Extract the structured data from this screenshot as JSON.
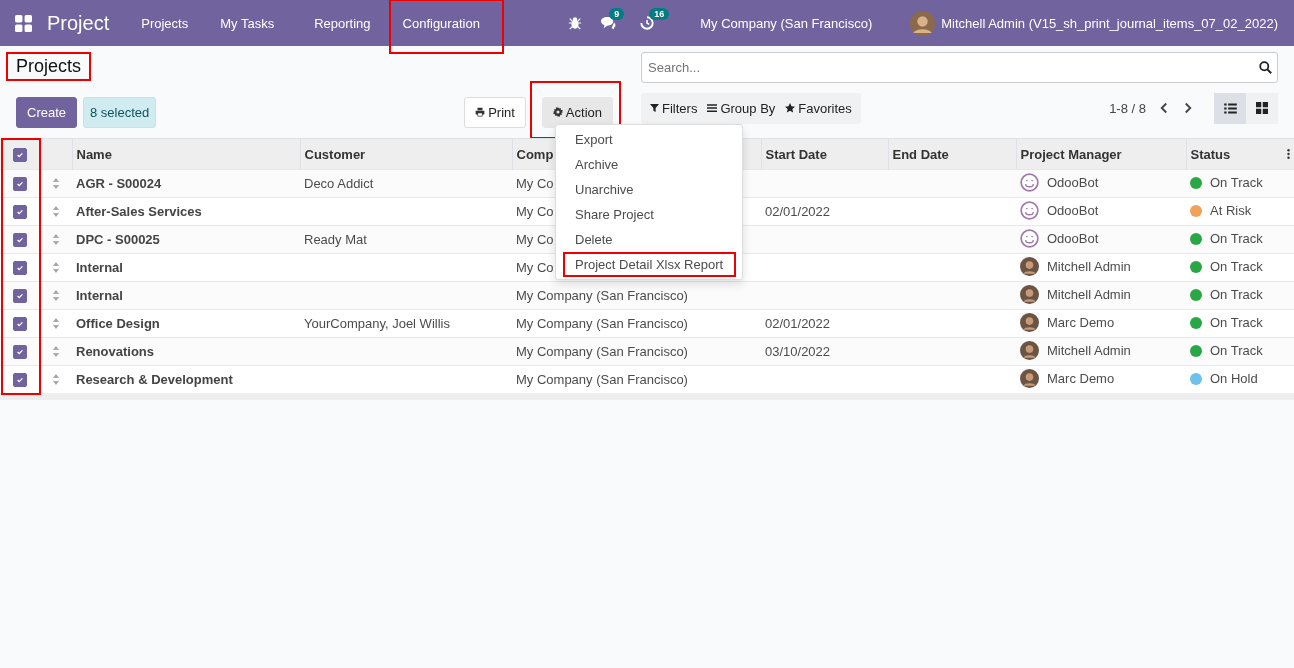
{
  "navbar": {
    "app_name": "Project",
    "menu": [
      {
        "label": "Projects",
        "highlighted": false
      },
      {
        "label": "My Tasks",
        "highlighted": false
      },
      {
        "label": "Reporting",
        "highlighted": false
      },
      {
        "label": "Configuration",
        "highlighted": true
      }
    ],
    "messages_count": "9",
    "activities_count": "16",
    "company": "My Company (San Francisco)",
    "user": "Mitchell Admin (V15_sh_print_journal_items_07_02_2022)"
  },
  "title": {
    "text": "Projects",
    "highlighted": true
  },
  "buttons": {
    "create": "Create",
    "selected": "8 selected",
    "print": "Print",
    "action": "Action",
    "action_highlighted": true
  },
  "search": {
    "placeholder": "Search..."
  },
  "filters": [
    "Filters",
    "Group By",
    "Favorites"
  ],
  "pager": "1-8 / 8",
  "views": [
    {
      "kind": "list",
      "selected": true
    },
    {
      "kind": "kanban",
      "selected": false
    }
  ],
  "action_menu": [
    {
      "label": "Export",
      "highlighted": false
    },
    {
      "label": "Archive",
      "highlighted": false
    },
    {
      "label": "Unarchive",
      "highlighted": false
    },
    {
      "label": "Share Project",
      "highlighted": false
    },
    {
      "label": "Delete",
      "highlighted": false
    },
    {
      "label": "Project Detail Xlsx Report",
      "highlighted": true
    }
  ],
  "table": {
    "select_all_checked": true,
    "select_column_highlighted": true,
    "columns": [
      "Name",
      "Customer",
      "Comp",
      "Start Date",
      "End Date",
      "Project Manager",
      "Status"
    ],
    "rows": [
      {
        "checked": true,
        "name": "AGR - S00024",
        "customer": "Deco Addict",
        "company": "My Co",
        "start_date": "",
        "end_date": "",
        "manager": "OdooBot",
        "kind": "bot",
        "status": "On Track",
        "color": "#28a745"
      },
      {
        "checked": true,
        "name": "After-Sales Services",
        "customer": "",
        "company": "My Co",
        "start_date": "02/01/2022",
        "end_date": "",
        "manager": "OdooBot",
        "kind": "bot",
        "status": "At Risk",
        "color": "#f0a15a"
      },
      {
        "checked": true,
        "name": "DPC - S00025",
        "customer": "Ready Mat",
        "company": "My Co",
        "start_date": "",
        "end_date": "",
        "manager": "OdooBot",
        "kind": "bot",
        "status": "On Track",
        "color": "#28a745"
      },
      {
        "checked": true,
        "name": "Internal",
        "customer": "",
        "company": "My Co",
        "start_date": "",
        "end_date": "",
        "manager": "Mitchell Admin",
        "kind": "person",
        "status": "On Track",
        "color": "#28a745"
      },
      {
        "checked": true,
        "name": "Internal",
        "customer": "",
        "company": "My Company (San Francisco)",
        "start_date": "",
        "end_date": "",
        "manager": "Mitchell Admin",
        "kind": "person",
        "status": "On Track",
        "color": "#28a745"
      },
      {
        "checked": true,
        "name": "Office Design",
        "customer": "YourCompany, Joel Willis",
        "company": "My Company (San Francisco)",
        "start_date": "02/01/2022",
        "end_date": "",
        "manager": "Marc Demo",
        "kind": "person",
        "status": "On Track",
        "color": "#28a745"
      },
      {
        "checked": true,
        "name": "Renovations",
        "customer": "",
        "company": "My Company (San Francisco)",
        "start_date": "03/10/2022",
        "end_date": "",
        "manager": "Mitchell Admin",
        "kind": "person",
        "status": "On Track",
        "color": "#28a745"
      },
      {
        "checked": true,
        "name": "Research & Development",
        "customer": "",
        "company": "My Company (San Francisco)",
        "start_date": "",
        "end_date": "",
        "manager": "Marc Demo",
        "kind": "person",
        "status": "On Hold",
        "color": "#6cc1ed"
      }
    ]
  }
}
